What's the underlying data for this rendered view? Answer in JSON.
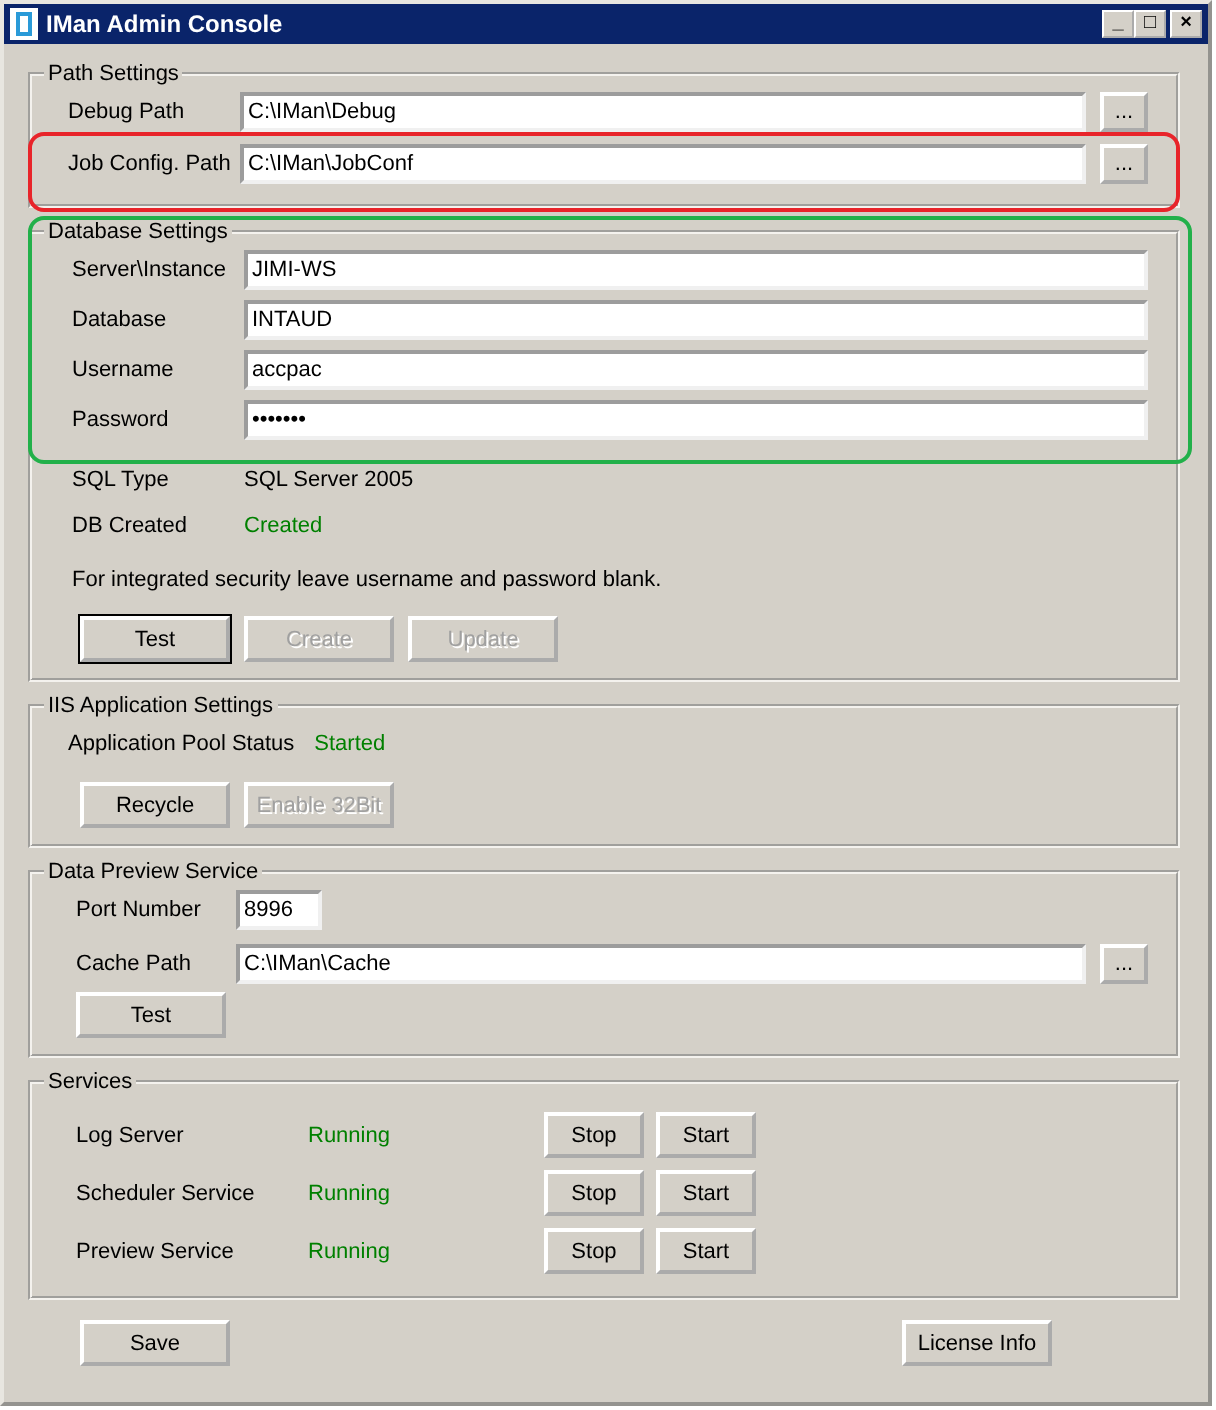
{
  "window": {
    "title": "IMan Admin Console",
    "controls": [
      "_",
      "□",
      "×"
    ]
  },
  "path_settings": {
    "title": "Path Settings",
    "rows": [
      {
        "label": "Debug Path",
        "value": "C:\\IMan\\Debug",
        "browse": "..."
      },
      {
        "label": "Job Config. Path",
        "value": "C:\\IMan\\JobConf",
        "browse": "..."
      }
    ]
  },
  "database_settings": {
    "title": "Database Settings",
    "fields": [
      {
        "label": "Server\\Instance",
        "value": "JIMI-WS"
      },
      {
        "label": "Database",
        "value": "INTAUD"
      },
      {
        "label": "Username",
        "value": "accpac"
      },
      {
        "label": "Password",
        "value": "•••••••"
      }
    ],
    "info": [
      {
        "label": "SQL Type",
        "value": "SQL Server 2005",
        "color": "#000000"
      },
      {
        "label": "DB Created",
        "value": "Created",
        "color": "#008000"
      }
    ],
    "note": "For integrated security leave username and password blank.",
    "buttons": [
      {
        "label": "Test",
        "disabled": false,
        "default": true
      },
      {
        "label": "Create",
        "disabled": true,
        "default": false
      },
      {
        "label": "Update",
        "disabled": true,
        "default": false
      }
    ]
  },
  "iis_settings": {
    "title": "IIS Application Settings",
    "status_label": "Application Pool Status",
    "status": "Started",
    "buttons": [
      {
        "label": "Recycle",
        "disabled": false
      },
      {
        "label": "Enable 32Bit",
        "disabled": true
      }
    ]
  },
  "data_preview": {
    "title": "Data Preview Service",
    "port": {
      "label": "Port Number",
      "value": "8996"
    },
    "cache_path": {
      "label": "Cache Path",
      "value": "C:\\IMan\\Cache",
      "browse": "..."
    },
    "test_button": "Test"
  },
  "services": {
    "title": "Services",
    "rows": [
      {
        "name": "Log Server",
        "status": "Running",
        "buttons": [
          "Stop",
          "Start"
        ]
      },
      {
        "name": "Scheduler Service",
        "status": "Running",
        "buttons": [
          "Stop",
          "Start"
        ]
      },
      {
        "name": "Preview Service",
        "status": "Running",
        "buttons": [
          "Stop",
          "Start"
        ]
      }
    ]
  },
  "footer_buttons": [
    "Save",
    "License Info"
  ],
  "highlights": [
    {
      "color": "#e8242a"
    },
    {
      "color": "#22b04a"
    }
  ]
}
